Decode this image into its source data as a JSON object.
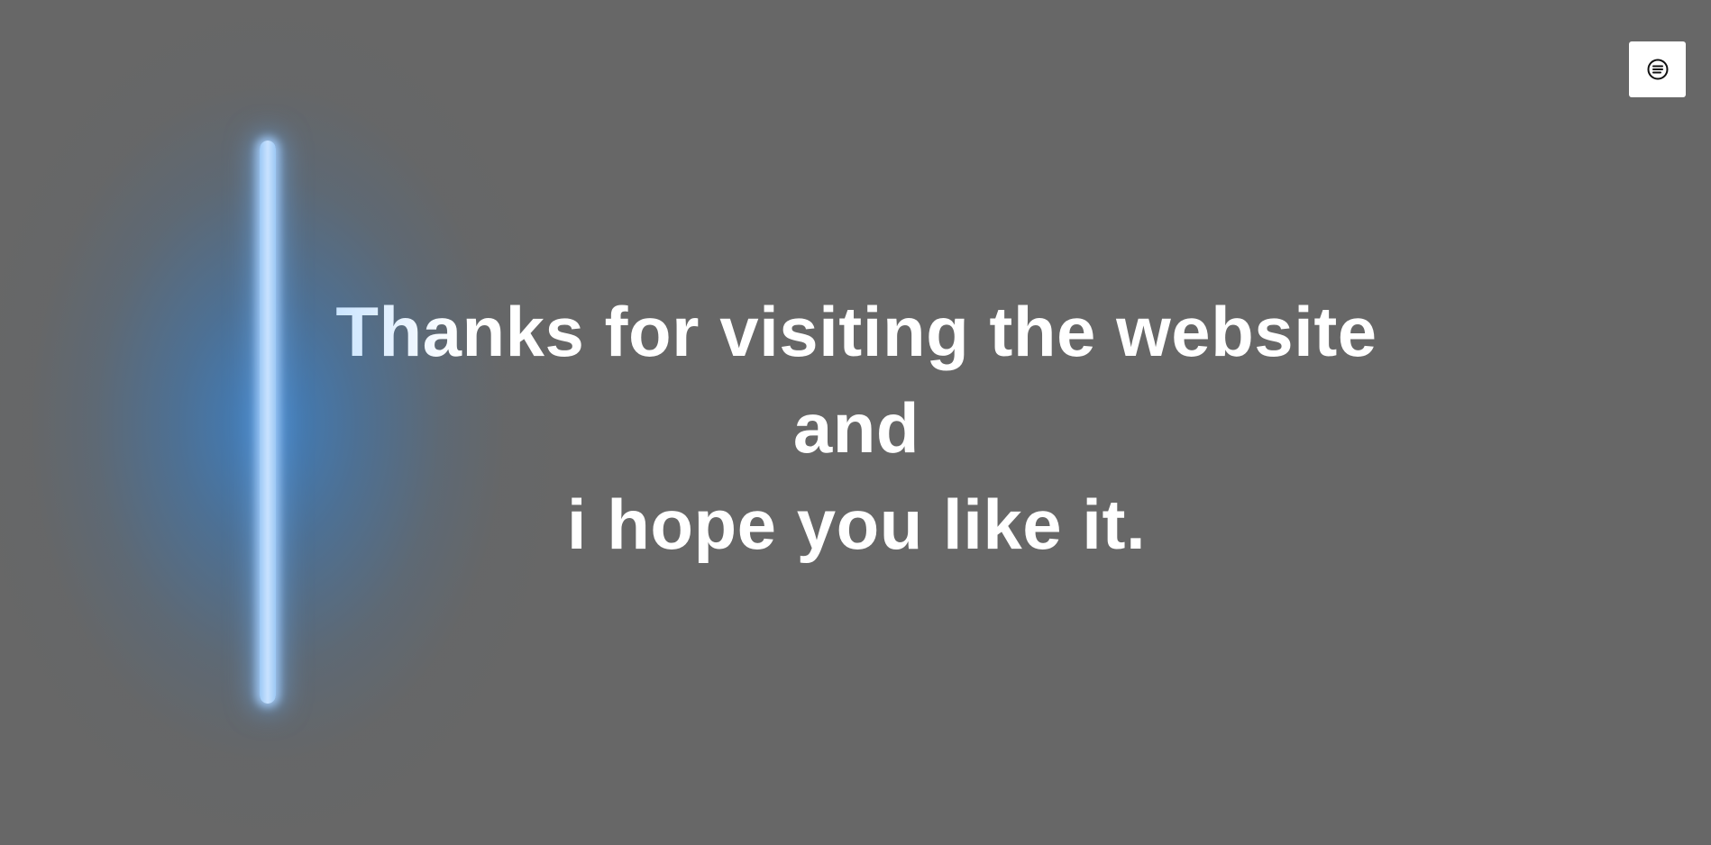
{
  "message": {
    "line1": "Thanks for visiting the website",
    "line2": "and",
    "line3": "i hope you like it."
  },
  "menu_button": {
    "icon": "menu-lines-circle-icon"
  },
  "colors": {
    "background": "#676767",
    "glow": "#3f82c6",
    "light_bar": "#c8e2ff",
    "text": "#ffffff"
  }
}
